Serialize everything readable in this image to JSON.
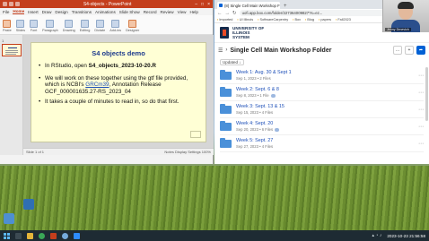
{
  "ppt": {
    "title": "S4-objects - PowerPoint",
    "menu": [
      "File",
      "Home",
      "Insert",
      "Draw",
      "Design",
      "Transitions",
      "Animations",
      "Slide Show",
      "Record",
      "Review",
      "View",
      "Help"
    ],
    "ribbon_groups": [
      "Paste",
      "Slides",
      "Font",
      "Paragraph",
      "Drawing",
      "Editing",
      "Dictate",
      "Add-ins",
      "Designer"
    ],
    "thumb_number": "1",
    "slide": {
      "title": "S4 objects demo",
      "bullets": [
        {
          "prefix": "In RStudio, open ",
          "bold": "S4_objects_2023-10-20.R",
          "suffix": ""
        },
        {
          "prefix": "We will work on these together using the gtf file provided, which is NCBI's ",
          "link": "GRCm39",
          "suffix": ", Annotation Release GCF_000001635.27-RS_2023_04"
        },
        {
          "prefix": "It takes a couple of minutes to read in, so do that first.",
          "bold": "",
          "suffix": ""
        }
      ],
      "bullet_char": "•"
    },
    "status_left": "Slide 1 of 1",
    "status_right": "Notes   Display Settings   100%"
  },
  "browser": {
    "tab_title": "(8) Single Cell Main Workshop F",
    "url": "uofi.app.box.com/folder/227364009827?s=ez...",
    "bookmarks": [
      "Imported",
      "UI Illinois",
      "SoftwareCarpentry",
      "Box",
      "Blog",
      "papers",
      "Fall2023",
      "Spring"
    ],
    "org_name_line1": "UNIVERSITY OF",
    "org_name_line2": "ILLINOIS",
    "org_name_line3": "SYSTEM",
    "webcam_name": "Jenny Drnevich",
    "folder_title": "Single Cell Main Workshop Folder",
    "sort_label": "Updated",
    "sort_arrow": "↓",
    "rows": [
      {
        "name": "Week 1: Aug. 30 & Sept 1",
        "meta": "Sep 1, 2023  •  2 Files"
      },
      {
        "name": "Week 2: Sept. 6 & 8",
        "meta": "Sep 8, 2023  •  1 File"
      },
      {
        "name": "Week 3: Sept. 13 & 15",
        "meta": "Sep 15, 2023  •  4 Files"
      },
      {
        "name": "Week 4: Sept. 20",
        "meta": "Sep 20, 2023  •  6 Files"
      },
      {
        "name": "Week 5: Sept. 27",
        "meta": "Sep 27, 2023  •  4 Files"
      }
    ]
  },
  "taskbar": {
    "clock": "2023-10-23  21:56:58"
  },
  "colors": {
    "ppt_accent": "#c43e1c",
    "box_blue": "#0061d5",
    "slide_bg": "#ffffd5",
    "slide_title": "#1c3a8c"
  }
}
